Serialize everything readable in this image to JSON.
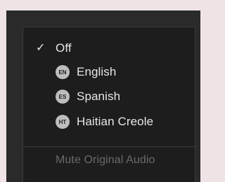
{
  "menu": {
    "items": [
      {
        "label": "Off",
        "checked": true,
        "check_mark": "✓"
      },
      {
        "label": "English",
        "badge": "EN"
      },
      {
        "label": "Spanish",
        "badge": "ES"
      },
      {
        "label": "Haitian Creole",
        "badge": "HT"
      }
    ],
    "mute_label": "Mute Original Audio",
    "mute_disabled": true
  },
  "colors": {
    "menu_background": "#1d1d1e",
    "text": "#e6e6e6",
    "badge": "#bdbdbd",
    "disabled_text": "#6a6a6b"
  }
}
